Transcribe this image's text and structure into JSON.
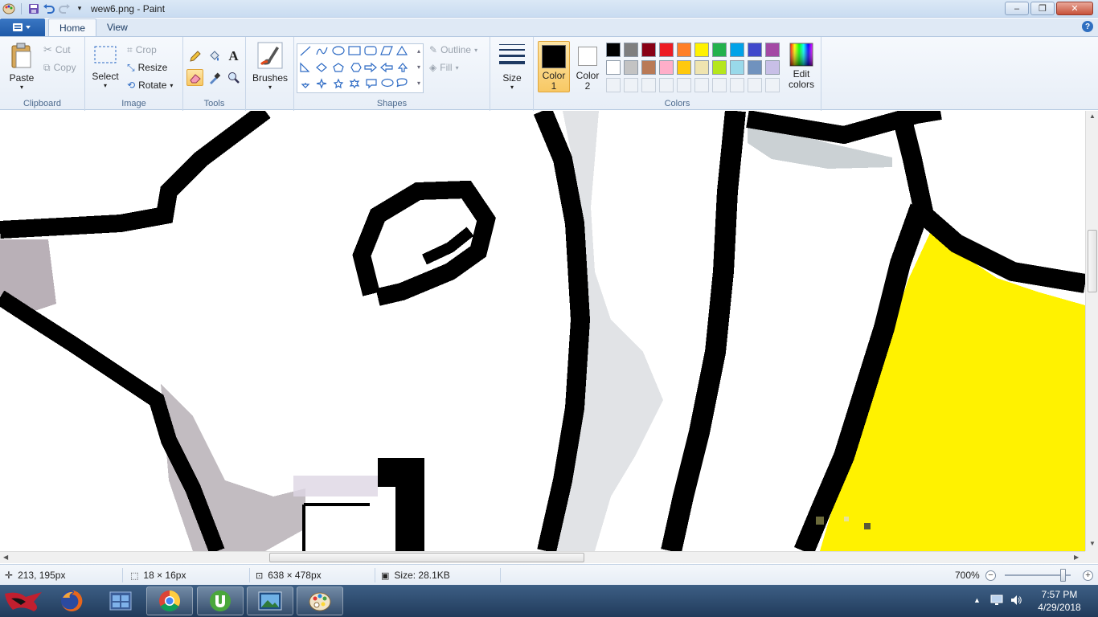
{
  "window": {
    "title": "wew6.png - Paint",
    "minimize": "‒",
    "maximize": "❐",
    "close": "✕"
  },
  "tabs": {
    "home": "Home",
    "view": "View",
    "help": "?"
  },
  "clipboard": {
    "paste": "Paste",
    "cut": "Cut",
    "copy": "Copy",
    "label": "Clipboard"
  },
  "image": {
    "select": "Select",
    "crop": "Crop",
    "resize": "Resize",
    "rotate": "Rotate",
    "label": "Image"
  },
  "tools": {
    "label": "Tools",
    "text_glyph": "A"
  },
  "brushes": {
    "label": "Brushes"
  },
  "shapes": {
    "outline": "Outline",
    "fill": "Fill",
    "label": "Shapes"
  },
  "size": {
    "label": "Size"
  },
  "colors": {
    "label": "Colors",
    "color1_label": "Color",
    "color1_num": "1",
    "color2_label": "Color",
    "color2_num": "2",
    "edit_label_1": "Edit",
    "edit_label_2": "colors",
    "color1": "#000000",
    "color2": "#ffffff",
    "palette_row1": [
      "#000000",
      "#7f7f7f",
      "#880015",
      "#ed1c24",
      "#ff7f27",
      "#fff200",
      "#22b14c",
      "#00a2e8",
      "#3f48cc",
      "#a349a4"
    ],
    "palette_row2": [
      "#ffffff",
      "#c3c3c3",
      "#b97a57",
      "#ffaec9",
      "#ffc90e",
      "#efe4b0",
      "#b5e61d",
      "#99d9ea",
      "#7092be",
      "#c8bfe7"
    ]
  },
  "status": {
    "cursor_pos": "213, 195px",
    "selection_size": "18 × 16px",
    "image_size": "638 × 478px",
    "file_size": "Size: 28.1KB",
    "zoom": "700%",
    "zoom_level_percent": 700,
    "zoom_out": "−",
    "zoom_in": "+"
  },
  "taskbar": {
    "apps": [
      "start-orb",
      "firefox",
      "task-manager",
      "chrome",
      "utorrent",
      "photo-viewer",
      "paint"
    ],
    "time": "7:57 PM",
    "date": "4/29/2018"
  }
}
